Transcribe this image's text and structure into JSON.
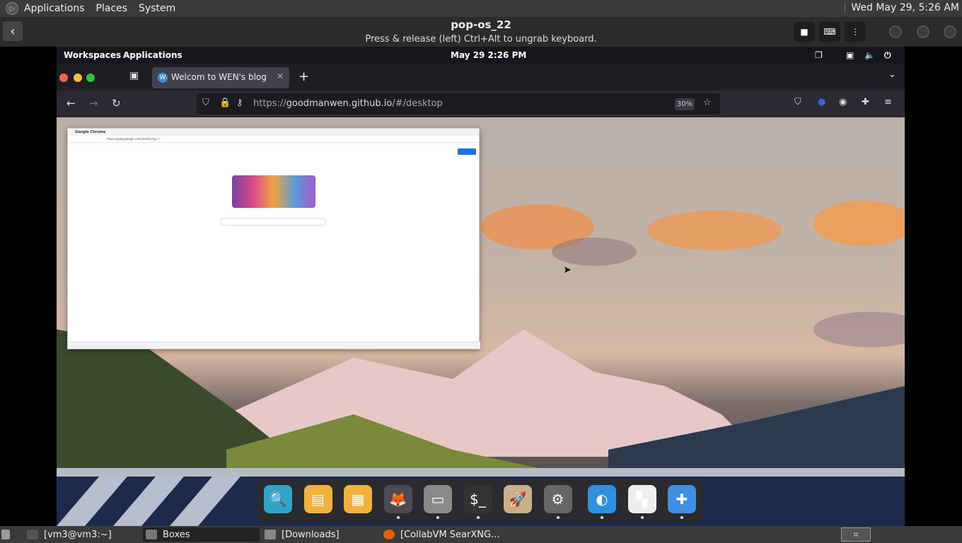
{
  "host_panel": {
    "menu": [
      "Applications",
      "Places",
      "System"
    ],
    "clock": "Wed May 29,  5:26 AM"
  },
  "boxes": {
    "title": "pop-os_22",
    "hint": "Press & release (left) Ctrl+Alt to ungrab keyboard."
  },
  "guest": {
    "topbar": {
      "workspaces": "Workspaces",
      "applications": "Applications",
      "datetime": "May 29    2:26 PM"
    },
    "firefox": {
      "tab_title": "Welcom to WEN's blog",
      "url_prefix": "https://",
      "url_domain": "goodmanwen.github.io",
      "url_path": "/#/desktop",
      "zoom": "30%"
    },
    "inner_chrome": {
      "title": "Google Chrome",
      "address": "https://www.google.com/webhp?gl=?"
    },
    "dock_items": [
      {
        "name": "search-app",
        "icon": "🔍",
        "color": "#2fa6c7"
      },
      {
        "name": "files-app",
        "icon": "▤",
        "color": "#f0b23a"
      },
      {
        "name": "app-grid",
        "icon": "▦",
        "color": "#f0b23a"
      },
      {
        "name": "firefox",
        "icon": "🦊",
        "color": "#4a4b55"
      },
      {
        "name": "file-manager",
        "icon": "▭",
        "color": "#8a8a8a"
      },
      {
        "name": "terminal",
        "icon": "$_",
        "color": "#333"
      },
      {
        "name": "launcher",
        "icon": "🚀",
        "color": "#c9b08a"
      },
      {
        "name": "settings",
        "icon": "⚙",
        "color": "#666"
      },
      {
        "name": "browser",
        "icon": "◐",
        "color": "#2f8fe0"
      },
      {
        "name": "pop-shop",
        "icon": "▚",
        "color": "#eee"
      },
      {
        "name": "extensions",
        "icon": "✚",
        "color": "#3f8fe3"
      }
    ]
  },
  "host_taskbar": {
    "items": [
      {
        "label": "[vm3@vm3:~]"
      },
      {
        "label": "Boxes"
      },
      {
        "label": "[Downloads]"
      },
      {
        "label": "[CollabVM SearXNG..."
      }
    ]
  }
}
